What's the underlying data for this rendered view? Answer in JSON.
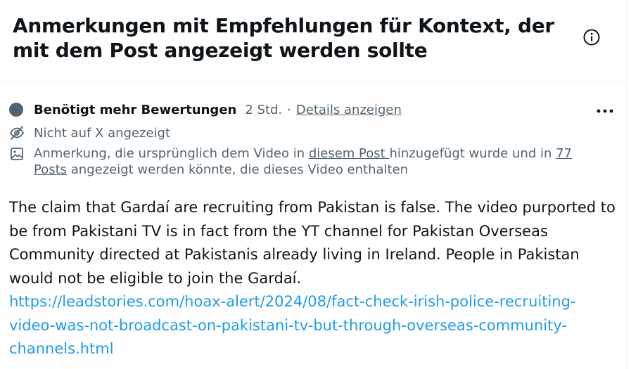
{
  "header": {
    "title": "Anmerkungen mit Empfehlungen für Kontext, der mit dem Post angezeigt werden sollte",
    "info_icon": "info-circle-icon"
  },
  "note": {
    "status_label": "Benötigt mehr Bewertungen",
    "time": "2 Std.",
    "separator": "·",
    "details_link": "Details anzeigen",
    "more_icon": "more-horizontal-icon",
    "visibility_icon": "eye-off-icon",
    "visibility_text": "Nicht auf X angezeigt",
    "media_icon": "image-icon",
    "media_text_1": "Anmerkung, die ursprünglich dem Video in ",
    "media_link_1": "diesem Post ",
    "media_text_2": "hinzugefügt wurde und in ",
    "media_link_2": "77 Posts",
    "media_text_3": " angezeigt werden könnte, die dieses Video enthalten",
    "body": "The claim that Gardaí are recruiting from Pakistan is false. The video purported to be from Pakistani TV is in fact from the YT channel for Pakistan Overseas Community directed at Pakistanis already living in Ireland. People in Pakistan would not be eligible to join the Gardaí.",
    "link": "https://leadstories.com/hoax-alert/2024/08/fact-check-irish-police-recruiting-video-was-not-broadcast-on-pakistani-tv-but-through-overseas-community-channels.html"
  },
  "colors": {
    "text_primary": "#0f1419",
    "text_secondary": "#536471",
    "link": "#1d9bf0",
    "border": "#eff3f4"
  }
}
